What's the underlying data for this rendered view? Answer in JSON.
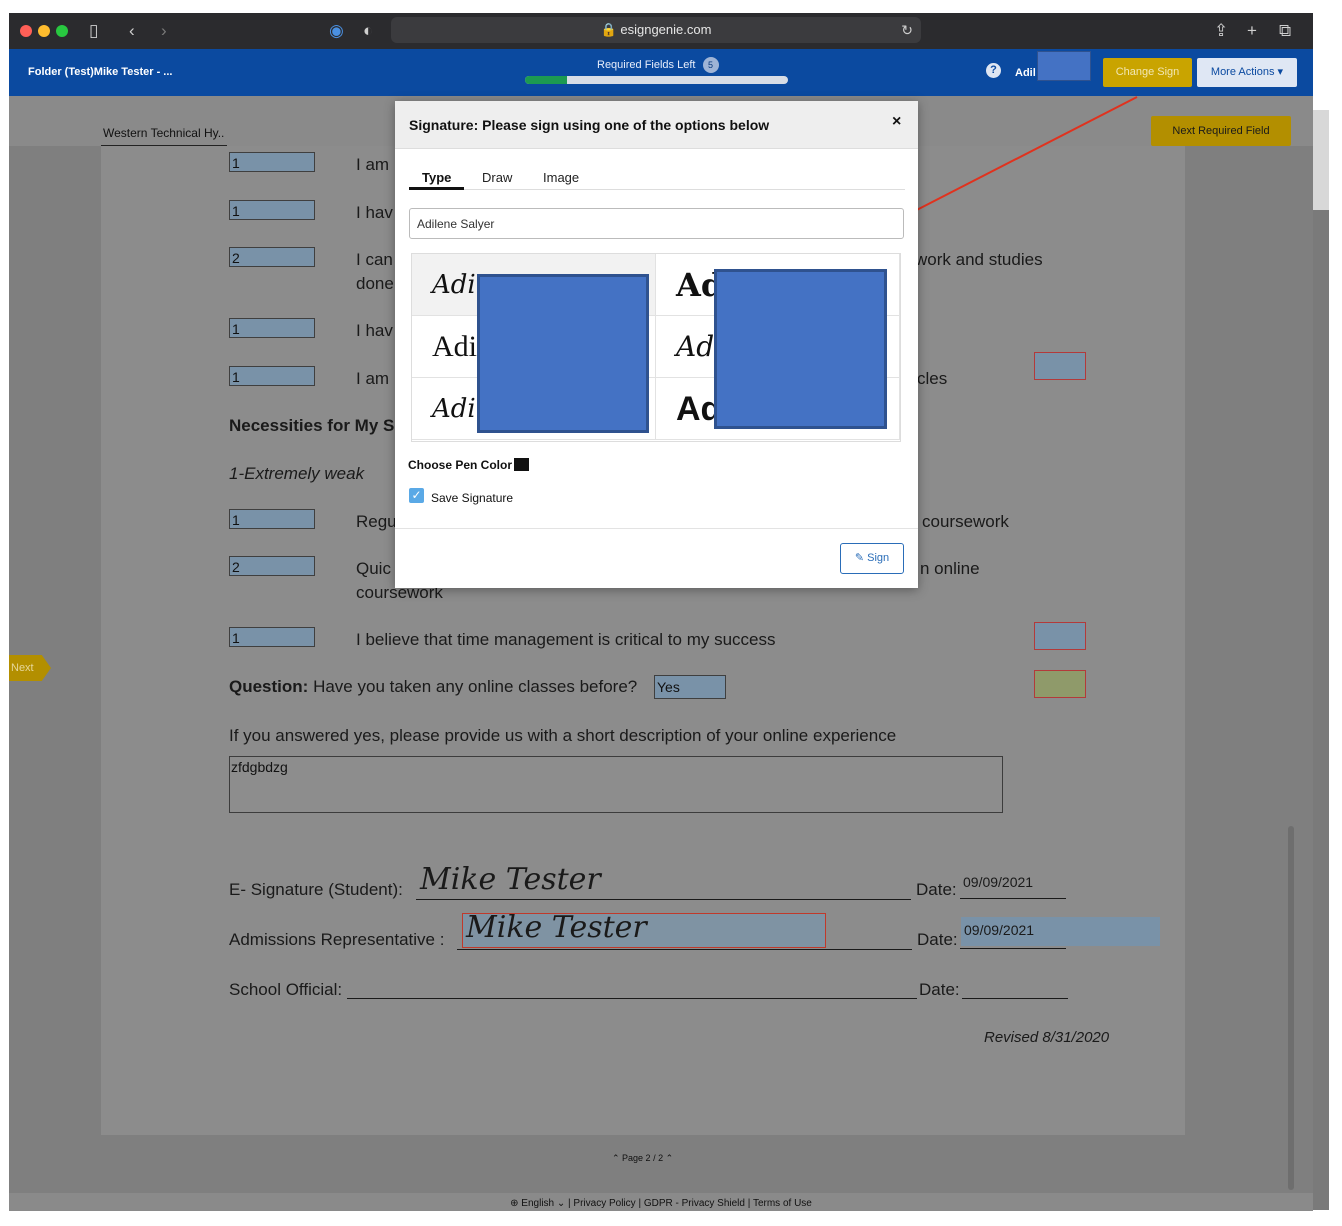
{
  "browser": {
    "url": "🔒 esigngenie.com"
  },
  "header": {
    "folder_title": "Folder (Test)Mike Tester - ...",
    "required_fields_label": "Required Fields Left",
    "required_fields_count": "5",
    "required_fields_progress": 0.16,
    "help": "?",
    "user_name": "Adil",
    "change_sign_label": "Change Sign",
    "more_actions_label": "More Actions ▾"
  },
  "document": {
    "tab_label": "Western Technical Hy..",
    "next_required_label": "Next Required Field",
    "next_tag": "Next",
    "rows": [
      {
        "value": "1",
        "text": "I am"
      },
      {
        "value": "1",
        "text": "I hav"
      },
      {
        "value": "2",
        "text": "I can",
        "text2": "done",
        "right": "work and studies"
      },
      {
        "value": "1",
        "text": "I hav"
      },
      {
        "value": "1",
        "text": "I am",
        "right": "cles"
      }
    ],
    "necessities_heading": "Necessities for My Su",
    "scale_note": "1-Extremely weak",
    "rows2": [
      {
        "value": "1",
        "text": "Regu",
        "right": "coursework"
      },
      {
        "value": "2",
        "text": "Quic",
        "text2": "coursework",
        "right": "n online"
      }
    ],
    "belief_value": "1",
    "belief_text": "I believe that time management is critical to my success",
    "question_label": "Question:",
    "question_text": "Have you taken any online classes before?",
    "question_answer": "Yes",
    "experience_prompt": "If you answered yes, please provide us with a short description of your online experience",
    "experience_answer": "zfdgbdzg",
    "student_sig_label": "E- Signature (Student):",
    "student_sig": "Mike Tester",
    "date_label": "Date:",
    "student_date": "09/09/2021",
    "admissions_label": "Admissions Representative :",
    "admissions_sig": "Mike Tester",
    "admissions_date": "09/09/2021",
    "school_official_label": "School Official:",
    "revised": "Revised 8/31/2020",
    "page_indicator": "⌃ Page 2 / 2 ⌃"
  },
  "footer": {
    "language": "⊕ English ⌄",
    "privacy": "Privacy Policy",
    "gdpr": "GDPR - Privacy Shield",
    "terms": "Terms of Use"
  },
  "modal": {
    "title": "Signature: Please sign using one of the options below",
    "close": "×",
    "tabs": [
      "Type",
      "Draw",
      "Image"
    ],
    "name_value": "Adilene Salyer",
    "signature_previews": [
      "Adi",
      "Ad",
      "Adi",
      "Adi",
      "Adi",
      "Ad"
    ],
    "pen_color_label": "Choose Pen Color",
    "pen_color": "#111111",
    "save_signature_label": "Save Signature",
    "save_signature_checked": true,
    "sign_label": "✎ Sign"
  },
  "colors": {
    "header_blue": "#0b4aa0",
    "accent_gold": "#c9a400",
    "redaction_blue": "#4472c4",
    "annotation_red": "#e0321e"
  }
}
